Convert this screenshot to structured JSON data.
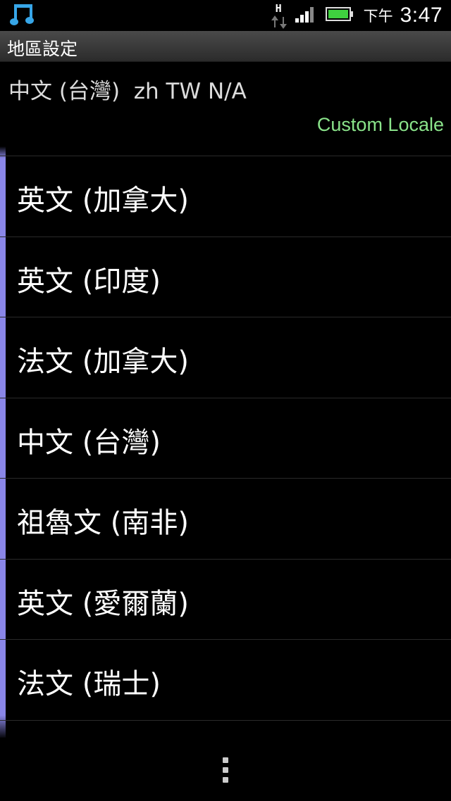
{
  "statusbar": {
    "ampm": "下午",
    "time": "3:47",
    "network_label": "H"
  },
  "header": {
    "title": "地區設定"
  },
  "current": {
    "locale_text": "中文 (台灣)  zh TW N/A",
    "custom_locale_label": "Custom Locale"
  },
  "list": {
    "items": [
      {
        "label": "英文 (加拿大)"
      },
      {
        "label": "英文 (印度)"
      },
      {
        "label": "法文 (加拿大)"
      },
      {
        "label": "中文 (台灣)"
      },
      {
        "label": "祖魯文 (南非)"
      },
      {
        "label": "英文 (愛爾蘭)"
      },
      {
        "label": "法文 (瑞士)"
      }
    ]
  },
  "colors": {
    "background": "#000000",
    "custom_locale": "#8ae38a",
    "scroll_indicator": "#8a86e8",
    "music_icon": "#37a6e8",
    "battery": "#3fd13f"
  }
}
